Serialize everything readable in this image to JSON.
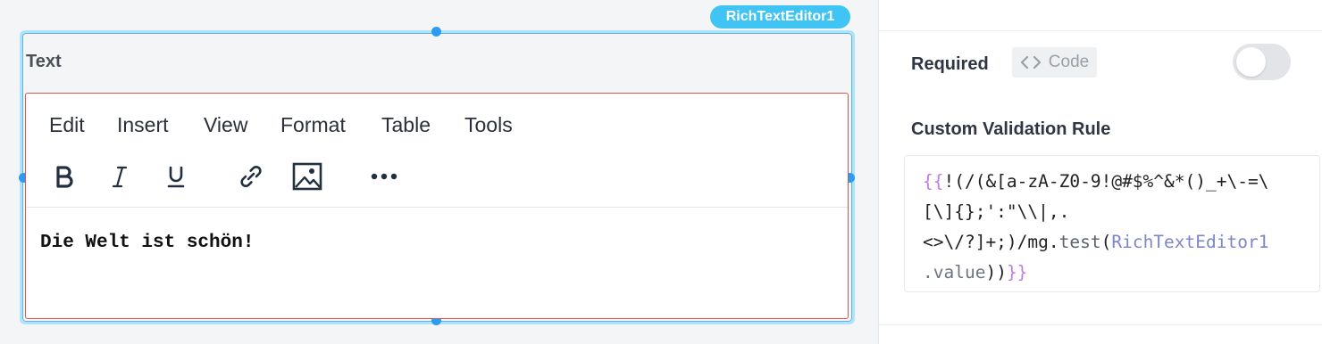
{
  "canvas": {
    "widget_badge": "RichTextEditor1",
    "widget_label": "Text",
    "menu": [
      "Edit",
      "Insert",
      "View",
      "Format",
      "Table",
      "Tools"
    ],
    "toolbar_icons": [
      "bold-icon",
      "italic-icon",
      "underline-icon",
      "link-icon",
      "image-icon",
      "more-icon"
    ],
    "content": "Die Welt ist schön!"
  },
  "pane": {
    "required_label": "Required",
    "code_chip_label": "Code",
    "required_enabled": false,
    "custom_validation_label": "Custom Validation Rule",
    "code_lines": [
      {
        "open": "{{",
        "text": "!(/(&[a-zA-Z0-9!@#$%^&*()_+\\-=\\"
      },
      {
        "text": "[\\]{};':\"\\\\|,."
      },
      {
        "pre": "<>\\/?]+;)/mg.",
        "fn": "test",
        "paren": "(",
        "ident": "RichTextEditor1"
      },
      {
        "dim": ".value",
        "close_paren": "))",
        "close": "}}"
      }
    ]
  },
  "colors": {
    "badge": "#40c4f3",
    "selection_border": "#aee3fb",
    "handle": "#2d9bf0",
    "editor_error_border": "#d9534f",
    "binding_brace": "#c07ce6"
  }
}
